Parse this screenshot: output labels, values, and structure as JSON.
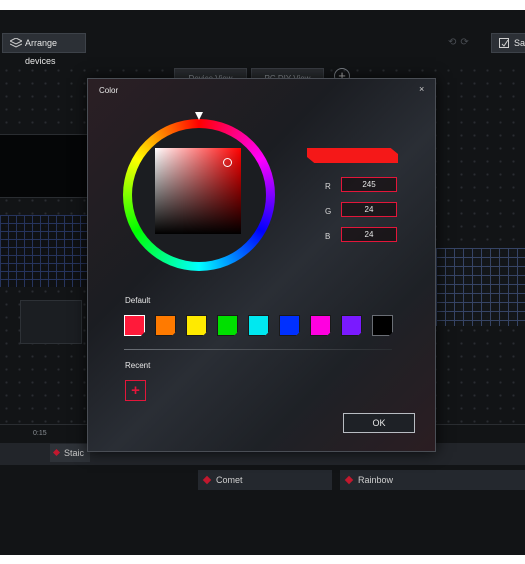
{
  "toolbar": {
    "arrange_label": "Arrange devices",
    "save_label": "Sav"
  },
  "view_tabs": [
    "Device View",
    "PC DIY View"
  ],
  "timeline": {
    "time_label": "0:15"
  },
  "tracks": {
    "static_label": "Staic"
  },
  "effects": [
    "Comet",
    "Rainbow"
  ],
  "dialog": {
    "title": "Color",
    "close_glyph": "×",
    "selected_color": "#f51818",
    "rgb": {
      "r_label": "R",
      "r_value": "245",
      "g_label": "G",
      "g_value": "24",
      "b_label": "B",
      "b_value": "24"
    },
    "default_label": "Default",
    "default_swatches": [
      "#ff1a3a",
      "#ff7a00",
      "#ffea00",
      "#00e000",
      "#00e8f0",
      "#0030ff",
      "#ff00e0",
      "#7a1aff",
      "#000000"
    ],
    "recent_label": "Recent",
    "recent_add_glyph": "+",
    "ok_label": "OK"
  },
  "colors": {
    "accent": "#e3163a",
    "app_bg": "#121416"
  }
}
